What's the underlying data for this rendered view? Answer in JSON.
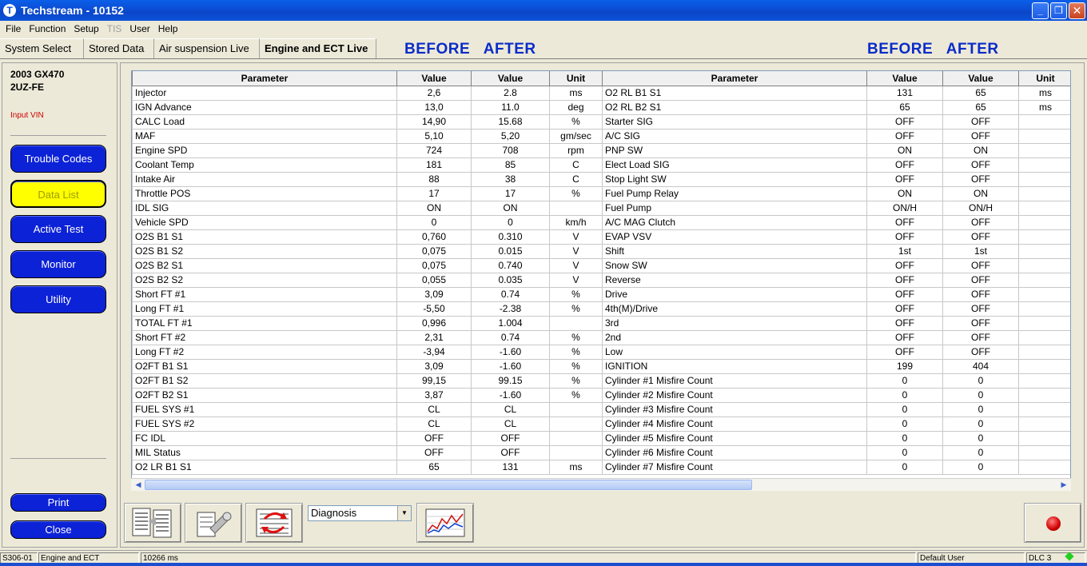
{
  "window": {
    "title": "Techstream - 10152",
    "app_icon": "T",
    "buttons": [
      "_",
      "❐",
      "✕"
    ]
  },
  "menu": [
    "File",
    "Function",
    "Setup",
    "TIS",
    "User",
    "Help"
  ],
  "tabs": [
    "System Select",
    "Stored Data",
    "Air suspension Live",
    "Engine and ECT Live"
  ],
  "overlay_labels": [
    "BEFORE   AFTER",
    "BEFORE   AFTER"
  ],
  "sidebar": {
    "vehicle_line1": "2003 GX470",
    "vehicle_line2": "2UZ-FE",
    "input_vin": "Input VIN",
    "buttons": [
      "Trouble Codes",
      "Data List",
      "Active Test",
      "Monitor",
      "Utility"
    ],
    "active": "Data List",
    "print": "Print",
    "close": "Close"
  },
  "table": {
    "headers": [
      "Parameter",
      "Value",
      "Value",
      "Unit"
    ],
    "left_rows": [
      [
        "Injector",
        "2,6",
        "2.8",
        "ms"
      ],
      [
        "IGN Advance",
        "13,0",
        "11.0",
        "deg"
      ],
      [
        "CALC Load",
        "14,90",
        "15.68",
        "%"
      ],
      [
        "MAF",
        "5,10",
        "5,20",
        "gm/sec"
      ],
      [
        "Engine SPD",
        "724",
        "708",
        "rpm"
      ],
      [
        "Coolant Temp",
        "181",
        "85",
        "C"
      ],
      [
        "Intake Air",
        "88",
        "38",
        "C"
      ],
      [
        "Throttle POS",
        "17",
        "17",
        "%"
      ],
      [
        "IDL SIG",
        "ON",
        "ON",
        ""
      ],
      [
        "Vehicle SPD",
        "0",
        "0",
        "km/h"
      ],
      [
        "O2S B1 S1",
        "0,760",
        "0.310",
        "V"
      ],
      [
        "O2S B1 S2",
        "0,075",
        "0.015",
        "V"
      ],
      [
        "O2S B2 S1",
        "0,075",
        "0.740",
        "V"
      ],
      [
        "O2S B2 S2",
        "0,055",
        "0.035",
        "V"
      ],
      [
        "Short FT #1",
        "3,09",
        "0.74",
        "%"
      ],
      [
        "Long FT #1",
        "-5,50",
        "-2.38",
        "%"
      ],
      [
        "TOTAL FT #1",
        "0,996",
        "1.004",
        ""
      ],
      [
        "Short FT #2",
        "2,31",
        "0.74",
        "%"
      ],
      [
        "Long FT #2",
        "-3,94",
        "-1.60",
        "%"
      ],
      [
        "O2FT B1 S1",
        "3,09",
        "-1.60",
        "%"
      ],
      [
        "O2FT B1 S2",
        "99,15",
        "99.15",
        "%"
      ],
      [
        "O2FT B2 S1",
        "3,87",
        "-1.60",
        "%"
      ],
      [
        "FUEL SYS #1",
        "CL",
        "CL",
        ""
      ],
      [
        "FUEL SYS #2",
        "CL",
        "CL",
        ""
      ],
      [
        "FC IDL",
        "OFF",
        "OFF",
        ""
      ],
      [
        "MIL Status",
        "OFF",
        "OFF",
        ""
      ],
      [
        "O2 LR B1 S1",
        "65",
        "131",
        "ms"
      ]
    ],
    "right_rows": [
      [
        "O2 RL B1 S1",
        "131",
        "65",
        "ms"
      ],
      [
        "O2 RL B2 S1",
        "65",
        "65",
        "ms"
      ],
      [
        "Starter SIG",
        "OFF",
        "OFF",
        ""
      ],
      [
        "A/C SIG",
        "OFF",
        "OFF",
        ""
      ],
      [
        "PNP SW",
        "ON",
        "ON",
        ""
      ],
      [
        "Elect Load SIG",
        "OFF",
        "OFF",
        ""
      ],
      [
        "Stop Light SW",
        "OFF",
        "OFF",
        ""
      ],
      [
        "Fuel Pump Relay",
        "ON",
        "ON",
        ""
      ],
      [
        "Fuel Pump",
        "ON/H",
        "ON/H",
        ""
      ],
      [
        "A/C MAG Clutch",
        "OFF",
        "OFF",
        ""
      ],
      [
        "EVAP VSV",
        "OFF",
        "OFF",
        ""
      ],
      [
        "Shift",
        "1st",
        "1st",
        ""
      ],
      [
        "Snow SW",
        "OFF",
        "OFF",
        ""
      ],
      [
        "Reverse",
        "OFF",
        "OFF",
        ""
      ],
      [
        "Drive",
        "OFF",
        "OFF",
        ""
      ],
      [
        "4th(M)/Drive",
        "OFF",
        "OFF",
        ""
      ],
      [
        "3rd",
        "OFF",
        "OFF",
        ""
      ],
      [
        "2nd",
        "OFF",
        "OFF",
        ""
      ],
      [
        "Low",
        "OFF",
        "OFF",
        ""
      ],
      [
        "IGNITION",
        "199",
        "404",
        ""
      ],
      [
        "Cylinder #1 Misfire Count",
        "0",
        "0",
        ""
      ],
      [
        "Cylinder #2 Misfire Count",
        "0",
        "0",
        ""
      ],
      [
        "Cylinder #3 Misfire Count",
        "0",
        "0",
        ""
      ],
      [
        "Cylinder #4 Misfire Count",
        "0",
        "0",
        ""
      ],
      [
        "Cylinder #5 Misfire Count",
        "0",
        "0",
        ""
      ],
      [
        "Cylinder #6 Misfire Count",
        "0",
        "0",
        ""
      ],
      [
        "Cylinder #7 Misfire Count",
        "0",
        "0",
        ""
      ]
    ]
  },
  "toolbar": {
    "dropdown_value": "Diagnosis",
    "icons": [
      "data-list-icon",
      "flashlight-icon",
      "swap-icon",
      "graph-icon",
      "record-icon"
    ]
  },
  "status": {
    "code": "S306-01",
    "system": "Engine and ECT",
    "time": "10266 ms",
    "user": "Default User",
    "interface": "DLC 3"
  },
  "colors": {
    "title_bar": "#0b4fd6",
    "nav_button": "#0c22d6",
    "nav_active": "#ffff00",
    "overlay_text": "#0a2cc8",
    "vin_text": "#cc0000",
    "status_led": "#20d020"
  }
}
